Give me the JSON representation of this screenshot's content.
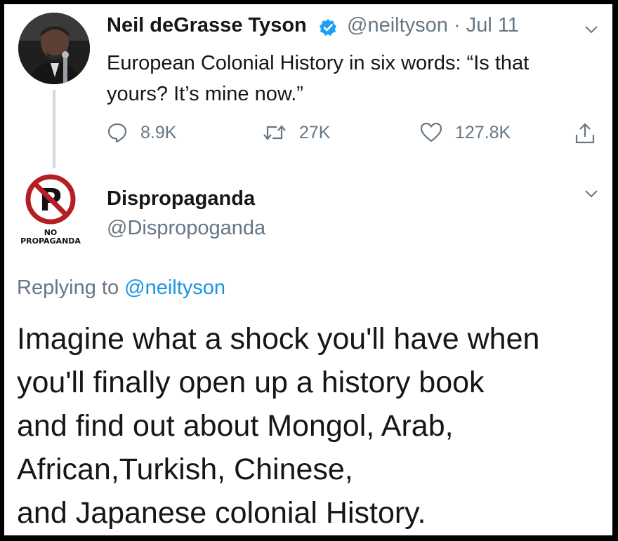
{
  "original_tweet": {
    "author_name": "Neil deGrasse Tyson",
    "handle": "@neiltyson",
    "date": "Jul 11",
    "separator": "·",
    "verified": true,
    "text": "European Colonial History in six words:  “Is that yours? It’s mine now.”",
    "actions": {
      "reply_count": "8.9K",
      "retweet_count": "27K",
      "like_count": "127.8K"
    }
  },
  "reply_tweet": {
    "author_name": "Dispropaganda",
    "handle": "@Dispropoganda",
    "avatar_caption": [
      "NO",
      "PROPAGANDA"
    ],
    "replying_prefix": "Replying to",
    "replying_to": "@neiltyson",
    "text_lines": [
      "Imagine what a shock you'll have when",
      "you'll finally open up a history book",
      "and find out about Mongol, Arab,",
      "African,Turkish, Chinese,",
      "and Japanese colonial History."
    ]
  },
  "icons": [
    "avatar-photo-icon",
    "verified-badge-icon",
    "chevron-down-icon",
    "reply-icon",
    "retweet-icon",
    "like-icon",
    "share-icon",
    "no-propaganda-logo-icon"
  ],
  "colors": {
    "text_primary": "#14171a",
    "text_secondary": "#657786",
    "link": "#1b95e0",
    "verified": "#1da1f2",
    "thread_line": "#cfd9de",
    "frame_border": "#000000"
  }
}
